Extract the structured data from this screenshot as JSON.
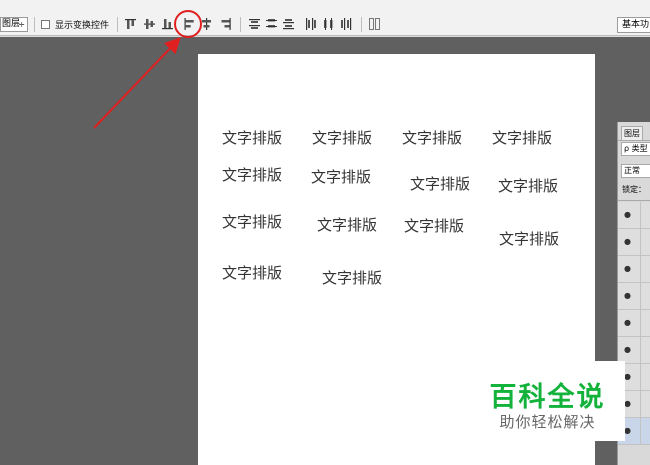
{
  "options_bar": {
    "layer_select_value": "图层",
    "show_transform_controls_label": "显示变换控件",
    "show_transform_controls_checked": false,
    "workspace_value": "基本功"
  },
  "document": {
    "words": [
      "文字排版",
      "文字排版",
      "文字排版",
      "文字排版",
      "文字排版",
      "文字排版",
      "文字排版",
      "文字排版",
      "文字排版",
      "文字排版",
      "文字排版",
      "文字排版",
      "文字排版",
      "文字排版"
    ]
  },
  "layers_panel": {
    "tab_label": "图层",
    "search_placeholder": "ρ 类型",
    "blend_mode": "正常",
    "lock_label": "锁定："
  },
  "watermark": {
    "title": "百科全说",
    "subtitle": "助你轻松解决"
  },
  "colors": {
    "annotation": "#e02020",
    "watermark_green": "#13b33b"
  }
}
